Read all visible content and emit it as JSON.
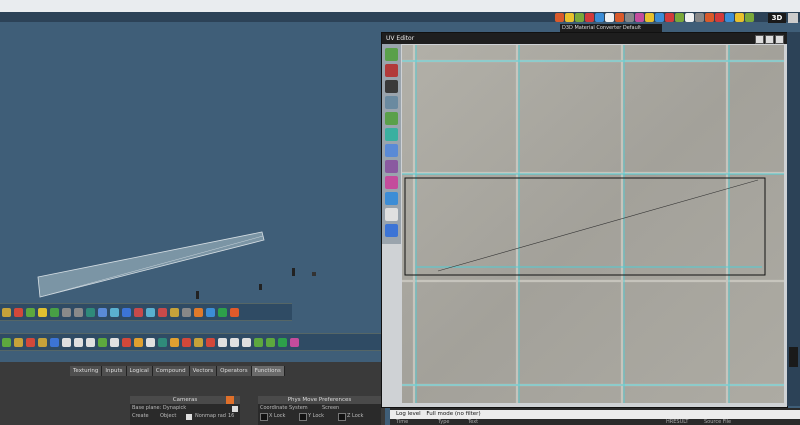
{
  "top_toolbar": {
    "button_3d_label": "3D",
    "icon_colors": [
      "#d95a2b",
      "#e8c02c",
      "#7aa83a",
      "#d23b3b",
      "#3c8dd6",
      "#f0f0f0",
      "#d95a2b",
      "#888888",
      "#c44c9c",
      "#e8c02c",
      "#3c8dd6",
      "#d23b3b",
      "#7aa83a",
      "#f0f0f0",
      "#888888",
      "#d95a2b",
      "#d23b3b",
      "#3c8dd6",
      "#e8c02c",
      "#7aa83a"
    ],
    "material_converter": "D3D Material Converter   Default"
  },
  "toolbar_a": {
    "icon_colors": [
      "#c6a23a",
      "#d2483a",
      "#5da83e",
      "#e0c030",
      "#48a045",
      "#8a8a8a",
      "#8a8a8a",
      "#2f8a7a",
      "#5a8ad6",
      "#5ab0d0",
      "#3c74d6",
      "#c84a4a",
      "#5ab0d0",
      "#c84a4a",
      "#c6a23a",
      "#888888",
      "#e07a2a",
      "#3c8dd6",
      "#2da04a",
      "#e05a2a"
    ]
  },
  "toolbar_b": {
    "icon_colors": [
      "#5da83e",
      "#c6a23a",
      "#d2483a",
      "#c6a23a",
      "#3c74d6",
      "#e0e0e0",
      "#e0e0e0",
      "#e0e0e0",
      "#5da83e",
      "#e0e0e0",
      "#d2483a",
      "#e0a030",
      "#e0e0e0",
      "#2f8a7a",
      "#e0a030",
      "#d2483a",
      "#c6a23a",
      "#d2483a",
      "#e0e0e0",
      "#e0e0e0",
      "#e0e0e0",
      "#5da83e",
      "#5da83e",
      "#2da04a",
      "#c44c9c"
    ]
  },
  "module_tabs": [
    {
      "label": "Texturing",
      "active": false
    },
    {
      "label": "Inputs",
      "active": false
    },
    {
      "label": "Logical",
      "active": false
    },
    {
      "label": "Compound",
      "active": false
    },
    {
      "label": "Vectors",
      "active": false
    },
    {
      "label": "Operators",
      "active": false
    },
    {
      "label": "Functions",
      "active": true
    }
  ],
  "cameras_panel": {
    "title": "Cameras",
    "base_plane": "Base plane: Dynapick",
    "create": "Create",
    "object": "Object",
    "nonmap_rad_label": "Nonmap rad",
    "nonmap_rad_value": "16"
  },
  "phys_panel": {
    "title": "Phys Move Preferences",
    "coordinate_system": "Coordinate System",
    "coordinate_value": "Screen",
    "x_lock": "X Lock",
    "y_lock": "Y Lock",
    "z_lock": "Z Lock"
  },
  "uv_editor": {
    "title": "UV Editor",
    "tool_colors": [
      "#5aa04a",
      "#b23a3a",
      "#3a3a3a",
      "#6a8aa0",
      "#5aa04a",
      "#3ab0a0",
      "#5a8ad6",
      "#8a5aa0",
      "#c44c9c",
      "#3c8dd6",
      "#e0e0e0",
      "#3c74d6"
    ]
  },
  "log_panel": {
    "tab_label": "Log level",
    "mode_label": "Full mode (no filter)",
    "col_time": "Time",
    "col_type": "Type",
    "col_text": "Text",
    "col_result": "HRESULT",
    "col_source": "Source File"
  }
}
